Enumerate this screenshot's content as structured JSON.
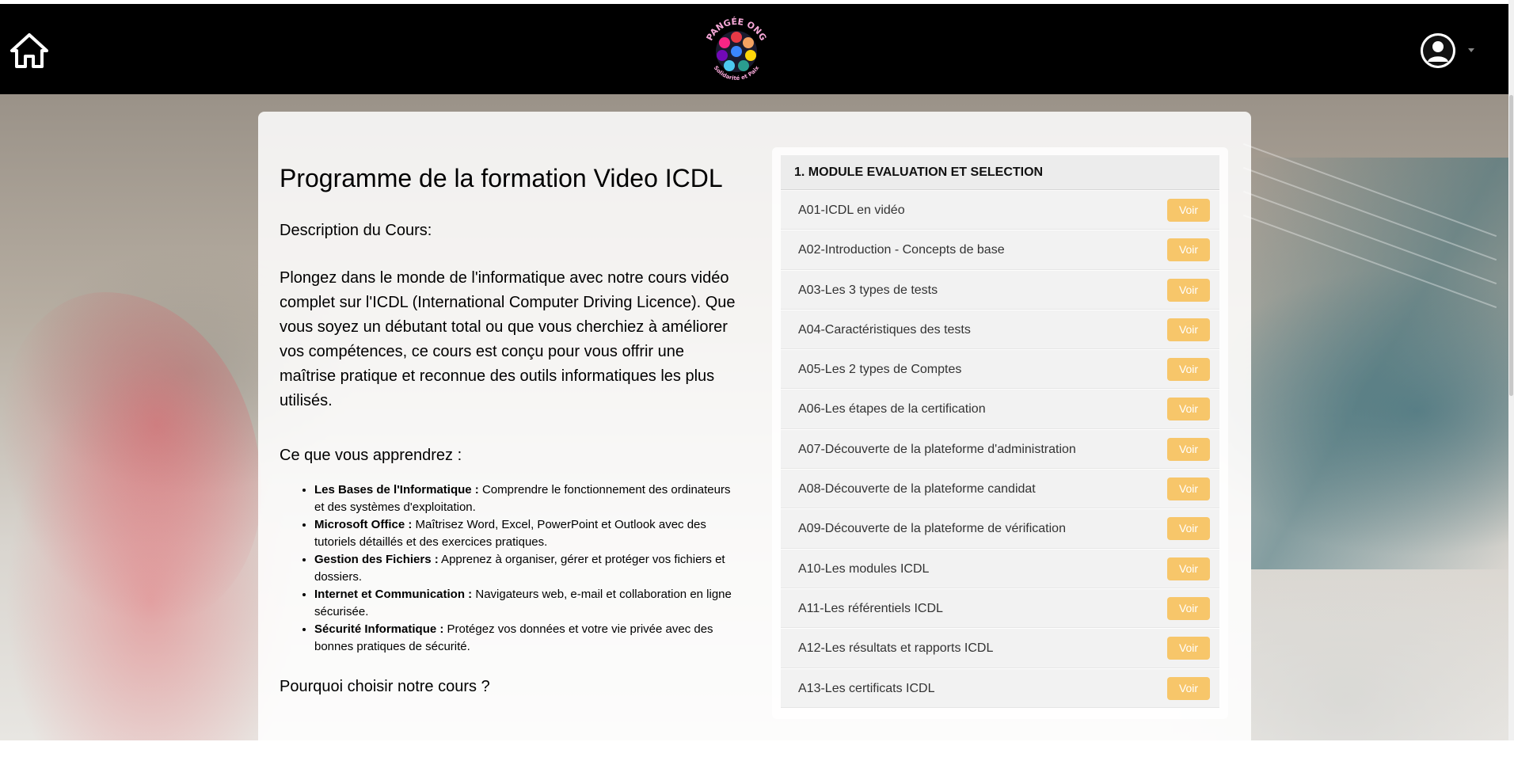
{
  "header": {
    "logo_text_top": "PANGÉE ONG",
    "logo_text_bottom": "Solidarité et Paix"
  },
  "main": {
    "title": "Programme de la formation Video ICDL",
    "description_heading": "Description du Cours:",
    "description_text": "Plongez dans le monde de l'informatique avec notre cours vidéo complet sur l'ICDL (International Computer Driving Licence). Que vous soyez un débutant total ou que vous cherchiez à améliorer vos compétences, ce cours est conçu pour vous offrir une maîtrise pratique et reconnue des outils informatiques les plus utilisés.",
    "learn_heading": "Ce que vous apprendrez :",
    "learn_items": [
      {
        "bold": "Les Bases de l'Informatique :",
        "text": " Comprendre le fonctionnement des ordinateurs et des systèmes d'exploitation."
      },
      {
        "bold": "Microsoft Office :",
        "text": " Maîtrisez Word, Excel, PowerPoint et Outlook avec des tutoriels détaillés et des exercices pratiques."
      },
      {
        "bold": "Gestion des Fichiers :",
        "text": " Apprenez à organiser, gérer et protéger vos fichiers et dossiers."
      },
      {
        "bold": "Internet et Communication :",
        "text": " Navigateurs web, e-mail et collaboration en ligne sécurisée."
      },
      {
        "bold": "Sécurité Informatique :",
        "text": " Protégez vos données et votre vie privée avec des bonnes pratiques de sécurité."
      }
    ],
    "why_heading": "Pourquoi choisir notre cours ?"
  },
  "modules": {
    "heading": "1. MODULE EVALUATION ET SELECTION",
    "button_label": "Voir",
    "items": [
      {
        "label": "A01-ICDL en vidéo",
        "button": "Voir"
      },
      {
        "label": "A02-Introduction - Concepts de base",
        "button": "Voir"
      },
      {
        "label": "A03-Les 3 types de tests",
        "button": "Voir"
      },
      {
        "label": "A04-Caractéristiques des tests",
        "button": "Voir"
      },
      {
        "label": "A05-Les 2 types de Comptes",
        "button": "Voir"
      },
      {
        "label": "A06-Les étapes de la certification",
        "button": "Voir"
      },
      {
        "label": "A07-Découverte de la plateforme d'administration",
        "button": "Voir"
      },
      {
        "label": "A08-Découverte de la plateforme candidat",
        "button": "Voir"
      },
      {
        "label": "A09-Découverte de la plateforme de vérification",
        "button": "Voir"
      },
      {
        "label": "A10-Les modules ICDL",
        "button": "Voir"
      },
      {
        "label": "A11-Les référentiels ICDL",
        "button": "Voir"
      },
      {
        "label": "A12-Les résultats et rapports ICDL",
        "button": "Voir"
      },
      {
        "label": "A13-Les certificats ICDL",
        "button": "Voir"
      }
    ]
  },
  "colors": {
    "navbar": "#000000",
    "button": "#f7c66a",
    "panel_header": "#ececec"
  },
  "icons": [
    "home-icon",
    "user-avatar-icon",
    "caret-down-icon"
  ]
}
